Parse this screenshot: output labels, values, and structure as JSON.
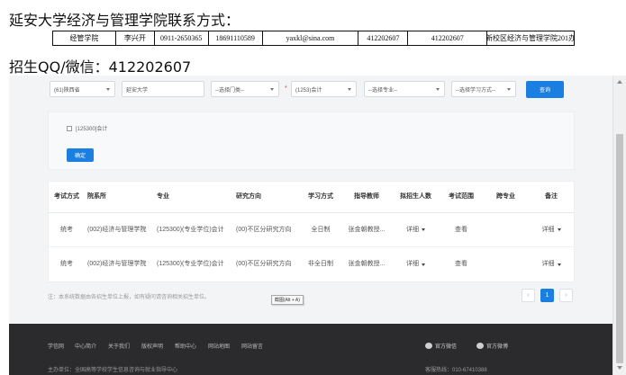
{
  "headings": {
    "contact": "延安大学经济与管理学院联系方式：",
    "qq": "招生QQ/微信：412202607"
  },
  "contact_row": [
    "经管学院",
    "李兴开",
    "0911-2650365",
    "18691110589",
    "yaxkl@sina.com",
    "412202607",
    "412202607",
    "新校区经济与管理学院201办"
  ],
  "filters": {
    "province": "(61)陕西省",
    "school": "延安大学",
    "category": "--选择门类--",
    "subject": "(1253)会计",
    "major": "--选择专业--",
    "mode": "--选择学习方式--",
    "query_label": "查询"
  },
  "major_panel": {
    "checkbox_label": "[125300]会计",
    "confirm_label": "确定"
  },
  "table": {
    "headers": [
      "考试方式",
      "院系所",
      "专业",
      "研究方向",
      "学习方式",
      "指导教师",
      "拟招生人数",
      "考试范围",
      "跨专业",
      "备注"
    ],
    "rows": [
      [
        "统考",
        "(002)经济与管理学院",
        "(125300)(专业学位)会计",
        "(00)不区分研究方向",
        "全日制",
        "张金朝教授...",
        "详细",
        "查看",
        "",
        "详细"
      ],
      [
        "统考",
        "(002)经济与管理学院",
        "(125300)(专业学位)会计",
        "(00)不区分研究方向",
        "非全日制",
        "张金朝教授...",
        "详细",
        "查看",
        "",
        "详细"
      ]
    ]
  },
  "footnote": "注：本系统数据由各招生单位上报，如有疑问请咨询相关招生单位。",
  "tooltip": "截图(Alt + A)",
  "pagination": {
    "prev": "‹",
    "current": "1",
    "next": "›"
  },
  "footer": {
    "links": [
      "学信网",
      "中心简介",
      "关于我们",
      "版权声明",
      "帮助中心",
      "网站地图",
      "网站留言"
    ],
    "wechat": "官方微信",
    "weibo": "官方微博",
    "sponsor": "主办单位：全国高等学校学生信息咨询与就业指导中心",
    "hotline": "客服热线：010-67410388"
  },
  "colors": {
    "accent": "#1a7fe0",
    "footer_bg": "#2b2b2d",
    "page_bg": "#f3f4f6"
  }
}
